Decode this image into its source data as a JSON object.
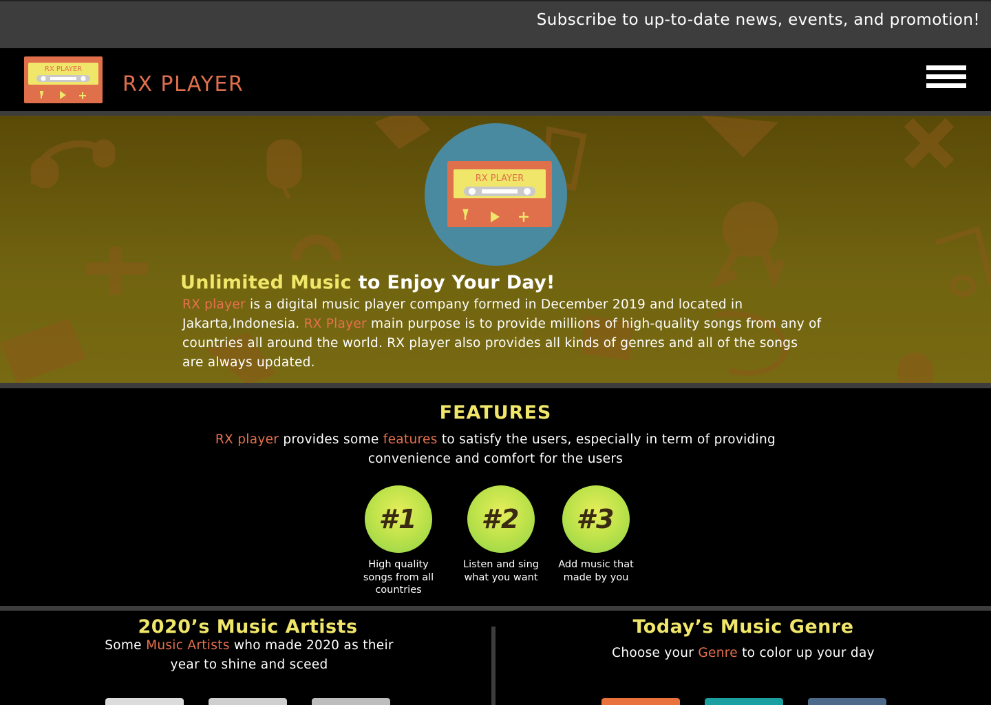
{
  "topbar": {
    "text": "Subscribe to up-to-date news, events, and promotion!"
  },
  "nav": {
    "brand": "RX PLAYER",
    "logo_label": "RX PLAYER",
    "menu_icon": "hamburger-menu-icon"
  },
  "hero": {
    "logo_label": "RX PLAYER",
    "title_highlight": "Unlimited Music",
    "title_rest": " to Enjoy Your Day!",
    "p1_brand": "RX player",
    "p1_text": " is a digital music player company formed in December 2019 and located in Jakarta,Indonesia. ",
    "p2_brand": "RX Player",
    "p2_text": " main purpose is to provide millions of high-quality songs from any of countries all around the world. RX player also provides all kinds of genres and all of the songs are always updated."
  },
  "features": {
    "title": "FEATURES",
    "lead_brand": "RX player",
    "lead_mid": " provides some ",
    "lead_kw": "features",
    "lead_rest": " to satisfy the users, especially in term of providing convenience and comfort for the users",
    "items": [
      {
        "badge": "#1",
        "caption": "High quality songs from all countries"
      },
      {
        "badge": "#2",
        "caption": "Listen and sing what you want"
      },
      {
        "badge": "#3",
        "caption": "Add music that made by you"
      }
    ]
  },
  "artists": {
    "title": "2020’s Music Artists",
    "text_pre": "Some ",
    "text_kw": "Music Artists",
    "text_post": " who made 2020 as their year to shine and sceed"
  },
  "genre": {
    "title": "Today’s Music Genre",
    "text_pre": "Choose your ",
    "text_kw": "Genre",
    "text_post": " to color up your day"
  },
  "colors": {
    "accent_orange": "#e06f4b",
    "accent_yellow": "#f0e66a",
    "circle_blue": "#4a8aa0",
    "feature_green": "#bde24a"
  }
}
